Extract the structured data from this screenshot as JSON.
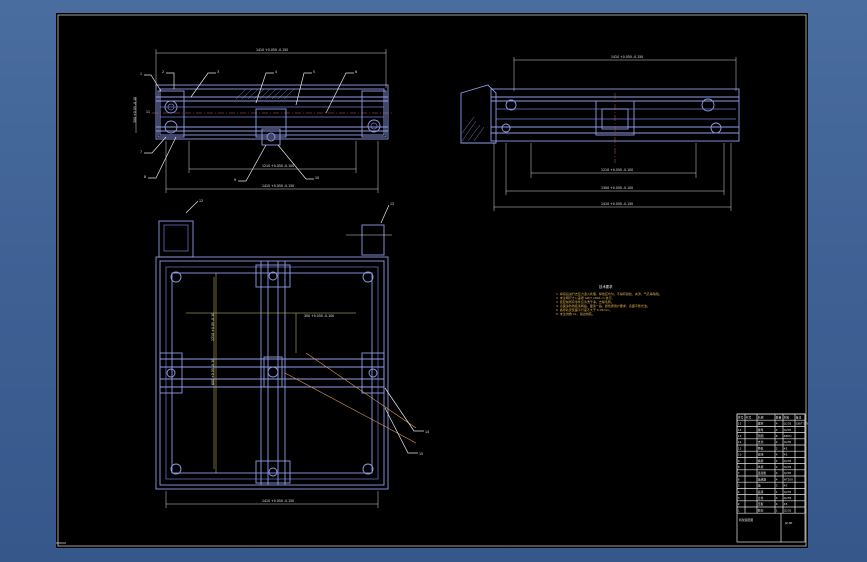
{
  "drawing": {
    "background": "#000000",
    "line_color": "#8f9ce8",
    "dim_color": "#d9d9d9",
    "note_color": "#e0b050"
  },
  "front_view": {
    "top_dim": "1410 +0.050 -0.150",
    "bottom_dim": "1410 +0.050 -0.150",
    "inner_dim": "1210 +0.050 -0.100",
    "left_dim": "300 +0.05 -0.10",
    "callouts": [
      "1",
      "2",
      "3",
      "4",
      "5",
      "6",
      "7",
      "8",
      "9",
      "10",
      "11"
    ]
  },
  "side_view": {
    "top_dim": "1410 +0.050 -0.150",
    "dim_a": "1210 +0.050 -0.100",
    "dim_b": "1300 +0.050 -0.100",
    "dim_c": "1410 +0.050 -0.150"
  },
  "plan_view": {
    "bottom_dim": "1410 +0.050 -0.150",
    "dim_mid": "300 +0.050 -0.100",
    "dim_left": "1210 +0.05 -0.10",
    "dim_left2": "600 +0.05 -0.10",
    "callouts": [
      "12",
      "13",
      "14",
      "15"
    ]
  },
  "notes": {
    "title": "技术要求",
    "lines": [
      "1. 焊接后进行去应力退火处理，焊缝应均匀，不得有裂纹、夹渣、气孔等缺陷。",
      "2. 未注明尺寸公差按 GB/T 1804-m 执行。",
      "3. 装配前所有零件应清洗干净，去除毛刺。",
      "4. 表面涂防锈底漆两遍，面漆一遍，颜色按用户要求，表面平整光洁。",
      "5. 各导轨安装面平行度不大于 0.05mm。",
      "6. 未注倒角 C1，锐边倒钝。"
    ]
  },
  "title_block": {
    "header": [
      "序号",
      "代号",
      "名称",
      "数量",
      "材料",
      "备注"
    ],
    "rows": [
      [
        "15",
        "",
        "螺栓",
        "4",
        "Q235",
        "GB/T 5782"
      ],
      [
        "14",
        "",
        "螺母",
        "4",
        "Q235",
        ""
      ],
      [
        "13",
        "",
        "垫圈",
        "8",
        "65Mn",
        ""
      ],
      [
        "12",
        "",
        "支架",
        "2",
        "Q235",
        ""
      ],
      [
        "11",
        "",
        "导轨",
        "2",
        "45",
        ""
      ],
      [
        "10",
        "",
        "滑块",
        "4",
        "45",
        ""
      ],
      [
        "9",
        "",
        "横梁",
        "2",
        "Q235",
        ""
      ],
      [
        "8",
        "",
        "纵梁",
        "2",
        "Q235",
        ""
      ],
      [
        "7",
        "",
        "连接板",
        "4",
        "Q235",
        ""
      ],
      [
        "6",
        "",
        "轴承座",
        "4",
        "HT200",
        ""
      ],
      [
        "5",
        "",
        "轴",
        "2",
        "45",
        ""
      ],
      [
        "4",
        "",
        "底座",
        "1",
        "Q235",
        ""
      ],
      [
        "3",
        "",
        "立柱",
        "4",
        "Q235",
        ""
      ],
      [
        "2",
        "",
        "压板",
        "4",
        "45",
        ""
      ],
      [
        "1",
        "",
        "框架",
        "1",
        "Q235",
        ""
      ]
    ],
    "drawing_name": "机架装配图",
    "drawing_no": "JZ-00"
  }
}
